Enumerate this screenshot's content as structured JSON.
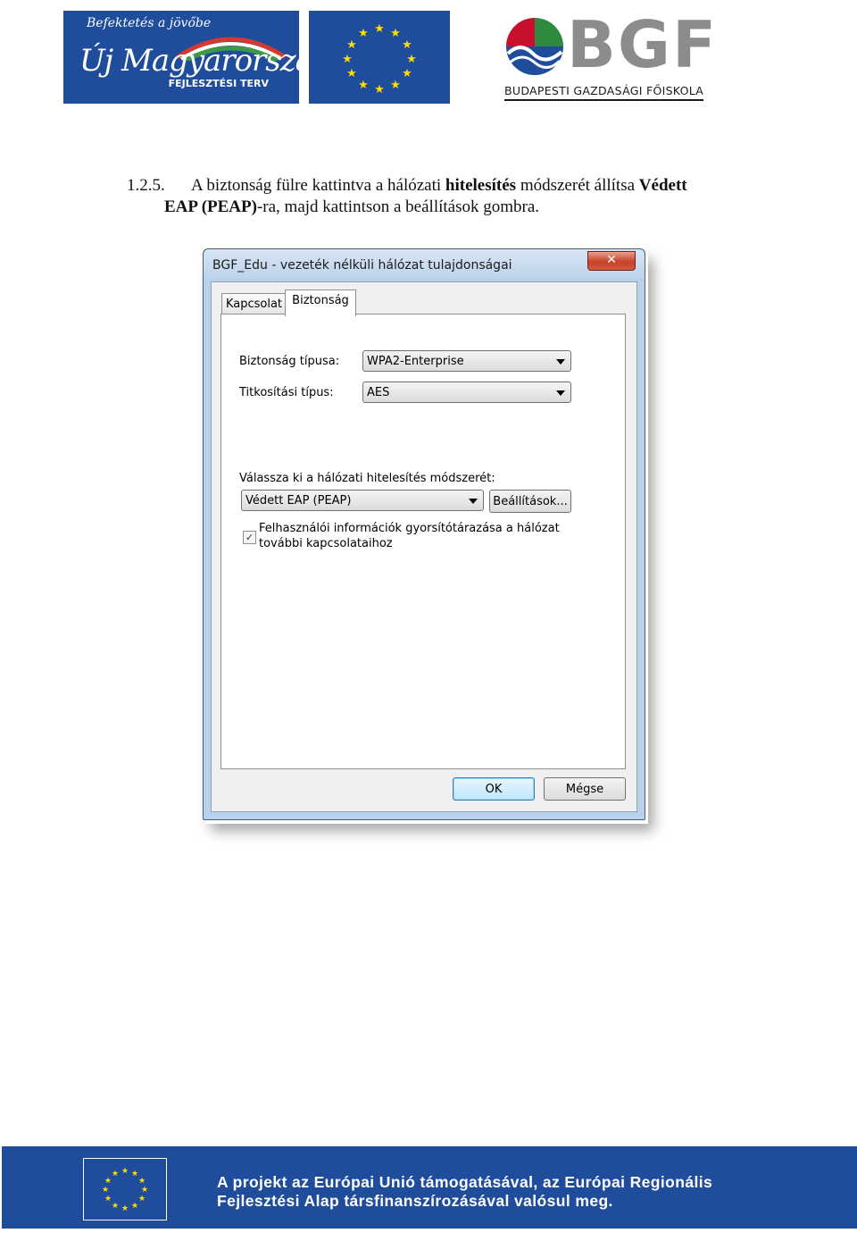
{
  "header": {
    "umft_logo": {
      "tagline": "Befektetés a jövőbe",
      "name": "Új Magyarország",
      "subtitle": "FEJLESZTÉSI TERV"
    },
    "bgf_logo": {
      "letters": "BGF",
      "subtitle": "BUDAPESTI GAZDASÁGI FŐISKOLA"
    }
  },
  "step": {
    "number": "1.2.5.",
    "text_a": "A biztonság fülre kattintva a hálózati ",
    "bold_a": "hitelesítés",
    "text_b": " módszerét állítsa ",
    "bold_b1": "Védett",
    "bold_b2": "EAP (PEAP)",
    "text_c": "-ra, majd kattintson a beállítások gombra."
  },
  "dialog": {
    "title": "BGF_Edu - vezeték nélküli hálózat tulajdonságai",
    "close_glyph": "✕",
    "tabs": [
      {
        "label": "Kapcsolat"
      },
      {
        "label": "Biztonság"
      }
    ],
    "security_type": {
      "label": "Biztonság típusa:",
      "value": "WPA2-Enterprise"
    },
    "encryption_type": {
      "label": "Titkosítási típus:",
      "value": "AES"
    },
    "auth_method": {
      "label": "Válassza ki a hálózati hitelesítés módszerét:",
      "value": "Védett EAP (PEAP)"
    },
    "settings_button": "Beállítások...",
    "cache_checkbox": {
      "checked": true,
      "mark": "✓",
      "line1": "Felhasználói információk gyorsítótárazása a hálózat",
      "line2": "további kapcsolataihoz"
    },
    "ok_button": "OK",
    "cancel_button": "Mégse"
  },
  "footer": {
    "line1": "A projekt az Európai Unió támogatásával, az Európai Regionális",
    "line2": "Fejlesztési Alap társfinanszírozásával valósul meg."
  },
  "colors": {
    "eu_blue": "#1f4d9c",
    "eu_star": "#ffdd00",
    "bgf_grey": "#8c8c8c",
    "window_frame": "#b9d1ea",
    "close_red": "#c7412c"
  }
}
